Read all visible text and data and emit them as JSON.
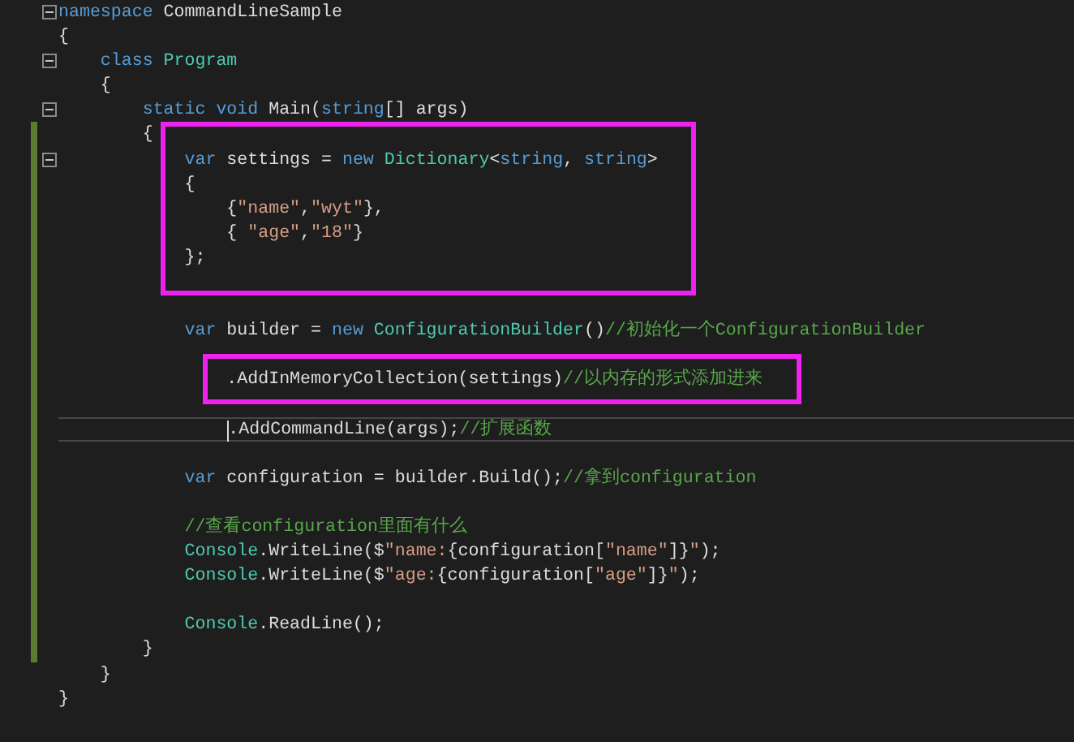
{
  "editor": {
    "lines": [
      {
        "kind": "line",
        "tokens": [
          {
            "kind": "keyword",
            "text": "namespace "
          },
          {
            "kind": "plain",
            "text": "CommandLineSample"
          }
        ],
        "fold": true,
        "changed": false,
        "current": false
      },
      {
        "kind": "line",
        "tokens": [
          {
            "kind": "plain",
            "text": "{"
          }
        ],
        "fold": false,
        "changed": false,
        "current": false
      },
      {
        "kind": "line",
        "tokens": [
          {
            "kind": "keyword",
            "text": "    class "
          },
          {
            "kind": "type",
            "text": "Program"
          }
        ],
        "fold": true,
        "changed": false,
        "current": false
      },
      {
        "kind": "line",
        "tokens": [
          {
            "kind": "plain",
            "text": "    {"
          }
        ],
        "fold": false,
        "changed": false,
        "current": false
      },
      {
        "kind": "line",
        "tokens": [
          {
            "kind": "keyword",
            "text": "        static void "
          },
          {
            "kind": "plain",
            "text": "Main("
          },
          {
            "kind": "keyword",
            "text": "string"
          },
          {
            "kind": "plain",
            "text": "[] args)"
          }
        ],
        "fold": true,
        "changed": false,
        "current": false
      },
      {
        "kind": "line",
        "tokens": [
          {
            "kind": "plain",
            "text": "        {"
          }
        ],
        "fold": false,
        "changed": true,
        "current": false
      },
      {
        "kind": "frame",
        "lines": [
          {
            "kind": "line",
            "tokens": [
              {
                "kind": "keyword",
                "text": "            var"
              },
              {
                "kind": "plain",
                "text": " settings = "
              },
              {
                "kind": "keyword",
                "text": "new "
              },
              {
                "kind": "type",
                "text": "Dictionary"
              },
              {
                "kind": "plain",
                "text": "<"
              },
              {
                "kind": "keyword",
                "text": "string"
              },
              {
                "kind": "plain",
                "text": ", "
              },
              {
                "kind": "keyword",
                "text": "string"
              },
              {
                "kind": "plain",
                "text": ">"
              }
            ],
            "fold": true,
            "changed": true,
            "current": false
          },
          {
            "kind": "line",
            "tokens": [
              {
                "kind": "plain",
                "text": "            {"
              }
            ],
            "fold": false,
            "changed": true,
            "current": false
          },
          {
            "kind": "line",
            "tokens": [
              {
                "kind": "plain",
                "text": "                {"
              },
              {
                "kind": "string",
                "text": "\"name\""
              },
              {
                "kind": "plain",
                "text": ","
              },
              {
                "kind": "string",
                "text": "\"wyt\""
              },
              {
                "kind": "plain",
                "text": "},"
              }
            ],
            "fold": false,
            "changed": true,
            "current": false
          },
          {
            "kind": "line",
            "tokens": [
              {
                "kind": "plain",
                "text": "                { "
              },
              {
                "kind": "string",
                "text": "\"age\""
              },
              {
                "kind": "plain",
                "text": ","
              },
              {
                "kind": "string",
                "text": "\"18\""
              },
              {
                "kind": "plain",
                "text": "}"
              }
            ],
            "fold": false,
            "changed": true,
            "current": false
          },
          {
            "kind": "line",
            "tokens": [
              {
                "kind": "plain",
                "text": "            };"
              }
            ],
            "fold": false,
            "changed": true,
            "current": false
          }
        ]
      },
      {
        "kind": "line",
        "fold": false,
        "changed": true,
        "current": false
      },
      {
        "kind": "line",
        "fold": false,
        "changed": true,
        "current": false
      },
      {
        "kind": "line",
        "tokens": [
          {
            "kind": "keyword",
            "text": "            var"
          },
          {
            "kind": "plain",
            "text": " builder = "
          },
          {
            "kind": "keyword",
            "text": "new "
          },
          {
            "kind": "type",
            "text": "ConfigurationBuilder"
          },
          {
            "kind": "plain",
            "text": "()"
          },
          {
            "kind": "comment",
            "text": "//初始化一个ConfigurationBuilder"
          }
        ],
        "fold": false,
        "changed": true,
        "current": false
      },
      {
        "kind": "line",
        "fold": false,
        "changed": true,
        "current": false
      },
      {
        "kind": "frame",
        "lines": [
          {
            "kind": "line",
            "tokens": [
              {
                "kind": "plain",
                "text": "                .AddInMemoryCollection(settings)"
              },
              {
                "kind": "comment",
                "text": "//以内存的形式添加进来"
              }
            ],
            "fold": false,
            "changed": true,
            "current": false
          }
        ]
      },
      {
        "kind": "line",
        "fold": false,
        "changed": true,
        "current": false
      },
      {
        "kind": "line",
        "tokens": [
          {
            "kind": "plain",
            "text": "                .AddCommandLine(args);"
          },
          {
            "kind": "comment",
            "text": "//扩展函数"
          }
        ],
        "fold": false,
        "changed": true,
        "current": true
      },
      {
        "kind": "line",
        "fold": false,
        "changed": true,
        "current": false
      },
      {
        "kind": "line",
        "tokens": [
          {
            "kind": "keyword",
            "text": "            var"
          },
          {
            "kind": "plain",
            "text": " configuration = builder.Build();"
          },
          {
            "kind": "comment",
            "text": "//拿到configuration"
          }
        ],
        "fold": false,
        "changed": true,
        "current": false
      },
      {
        "kind": "line",
        "fold": false,
        "changed": true,
        "current": false
      },
      {
        "kind": "line",
        "tokens": [
          {
            "kind": "comment",
            "text": "            //查看configuration里面有什么"
          }
        ],
        "fold": false,
        "changed": true,
        "current": false
      },
      {
        "kind": "line",
        "tokens": [
          {
            "kind": "type",
            "text": "            Console"
          },
          {
            "kind": "plain",
            "text": ".WriteLine($"
          },
          {
            "kind": "string",
            "text": "\"name:"
          },
          {
            "kind": "plain",
            "text": "{configuration["
          },
          {
            "kind": "string",
            "text": "\"name\""
          },
          {
            "kind": "plain",
            "text": "]}"
          },
          {
            "kind": "string",
            "text": "\""
          },
          {
            "kind": "plain",
            "text": ");"
          }
        ],
        "fold": false,
        "changed": true,
        "current": false
      },
      {
        "kind": "line",
        "tokens": [
          {
            "kind": "type",
            "text": "            Console"
          },
          {
            "kind": "plain",
            "text": ".WriteLine($"
          },
          {
            "kind": "string",
            "text": "\"age:"
          },
          {
            "kind": "plain",
            "text": "{configuration["
          },
          {
            "kind": "string",
            "text": "\"age\""
          },
          {
            "kind": "plain",
            "text": "]}"
          },
          {
            "kind": "string",
            "text": "\""
          },
          {
            "kind": "plain",
            "text": ");"
          }
        ],
        "fold": false,
        "changed": true,
        "current": false
      },
      {
        "kind": "line",
        "fold": false,
        "changed": true,
        "current": false
      },
      {
        "kind": "line",
        "tokens": [
          {
            "kind": "type",
            "text": "            Console"
          },
          {
            "kind": "plain",
            "text": ".ReadLine();"
          }
        ],
        "fold": false,
        "changed": true,
        "current": false
      },
      {
        "kind": "line",
        "tokens": [
          {
            "kind": "plain",
            "text": "        }"
          }
        ],
        "fold": false,
        "changed": true,
        "current": false
      },
      {
        "kind": "line",
        "tokens": [
          {
            "kind": "plain",
            "text": "    }"
          }
        ],
        "fold": false,
        "changed": false,
        "current": false
      },
      {
        "kind": "line",
        "tokens": [
          {
            "kind": "plain",
            "text": "}"
          }
        ],
        "fold": false,
        "changed": false,
        "current": false
      }
    ]
  }
}
